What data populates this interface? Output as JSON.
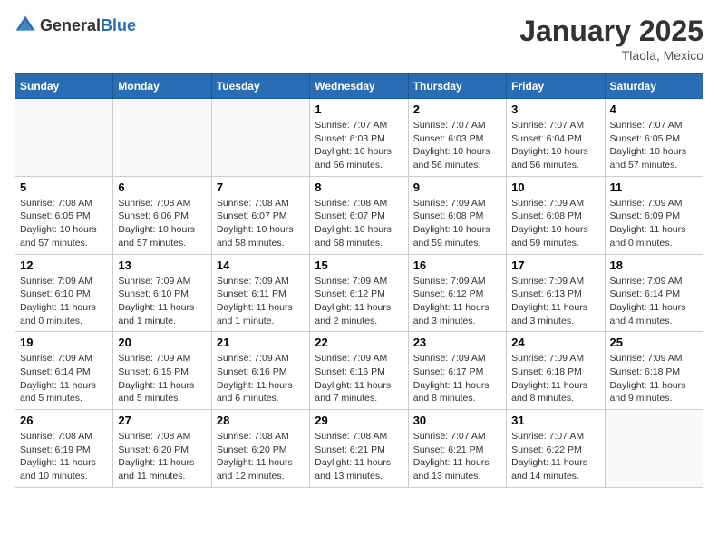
{
  "header": {
    "logo_general": "General",
    "logo_blue": "Blue",
    "month_title": "January 2025",
    "location": "Tlaola, Mexico"
  },
  "days_of_week": [
    "Sunday",
    "Monday",
    "Tuesday",
    "Wednesday",
    "Thursday",
    "Friday",
    "Saturday"
  ],
  "weeks": [
    [
      {
        "day": "",
        "info": ""
      },
      {
        "day": "",
        "info": ""
      },
      {
        "day": "",
        "info": ""
      },
      {
        "day": "1",
        "info": "Sunrise: 7:07 AM\nSunset: 6:03 PM\nDaylight: 10 hours\nand 56 minutes."
      },
      {
        "day": "2",
        "info": "Sunrise: 7:07 AM\nSunset: 6:03 PM\nDaylight: 10 hours\nand 56 minutes."
      },
      {
        "day": "3",
        "info": "Sunrise: 7:07 AM\nSunset: 6:04 PM\nDaylight: 10 hours\nand 56 minutes."
      },
      {
        "day": "4",
        "info": "Sunrise: 7:07 AM\nSunset: 6:05 PM\nDaylight: 10 hours\nand 57 minutes."
      }
    ],
    [
      {
        "day": "5",
        "info": "Sunrise: 7:08 AM\nSunset: 6:05 PM\nDaylight: 10 hours\nand 57 minutes."
      },
      {
        "day": "6",
        "info": "Sunrise: 7:08 AM\nSunset: 6:06 PM\nDaylight: 10 hours\nand 57 minutes."
      },
      {
        "day": "7",
        "info": "Sunrise: 7:08 AM\nSunset: 6:07 PM\nDaylight: 10 hours\nand 58 minutes."
      },
      {
        "day": "8",
        "info": "Sunrise: 7:08 AM\nSunset: 6:07 PM\nDaylight: 10 hours\nand 58 minutes."
      },
      {
        "day": "9",
        "info": "Sunrise: 7:09 AM\nSunset: 6:08 PM\nDaylight: 10 hours\nand 59 minutes."
      },
      {
        "day": "10",
        "info": "Sunrise: 7:09 AM\nSunset: 6:08 PM\nDaylight: 10 hours\nand 59 minutes."
      },
      {
        "day": "11",
        "info": "Sunrise: 7:09 AM\nSunset: 6:09 PM\nDaylight: 11 hours\nand 0 minutes."
      }
    ],
    [
      {
        "day": "12",
        "info": "Sunrise: 7:09 AM\nSunset: 6:10 PM\nDaylight: 11 hours\nand 0 minutes."
      },
      {
        "day": "13",
        "info": "Sunrise: 7:09 AM\nSunset: 6:10 PM\nDaylight: 11 hours\nand 1 minute."
      },
      {
        "day": "14",
        "info": "Sunrise: 7:09 AM\nSunset: 6:11 PM\nDaylight: 11 hours\nand 1 minute."
      },
      {
        "day": "15",
        "info": "Sunrise: 7:09 AM\nSunset: 6:12 PM\nDaylight: 11 hours\nand 2 minutes."
      },
      {
        "day": "16",
        "info": "Sunrise: 7:09 AM\nSunset: 6:12 PM\nDaylight: 11 hours\nand 3 minutes."
      },
      {
        "day": "17",
        "info": "Sunrise: 7:09 AM\nSunset: 6:13 PM\nDaylight: 11 hours\nand 3 minutes."
      },
      {
        "day": "18",
        "info": "Sunrise: 7:09 AM\nSunset: 6:14 PM\nDaylight: 11 hours\nand 4 minutes."
      }
    ],
    [
      {
        "day": "19",
        "info": "Sunrise: 7:09 AM\nSunset: 6:14 PM\nDaylight: 11 hours\nand 5 minutes."
      },
      {
        "day": "20",
        "info": "Sunrise: 7:09 AM\nSunset: 6:15 PM\nDaylight: 11 hours\nand 5 minutes."
      },
      {
        "day": "21",
        "info": "Sunrise: 7:09 AM\nSunset: 6:16 PM\nDaylight: 11 hours\nand 6 minutes."
      },
      {
        "day": "22",
        "info": "Sunrise: 7:09 AM\nSunset: 6:16 PM\nDaylight: 11 hours\nand 7 minutes."
      },
      {
        "day": "23",
        "info": "Sunrise: 7:09 AM\nSunset: 6:17 PM\nDaylight: 11 hours\nand 8 minutes."
      },
      {
        "day": "24",
        "info": "Sunrise: 7:09 AM\nSunset: 6:18 PM\nDaylight: 11 hours\nand 8 minutes."
      },
      {
        "day": "25",
        "info": "Sunrise: 7:09 AM\nSunset: 6:18 PM\nDaylight: 11 hours\nand 9 minutes."
      }
    ],
    [
      {
        "day": "26",
        "info": "Sunrise: 7:08 AM\nSunset: 6:19 PM\nDaylight: 11 hours\nand 10 minutes."
      },
      {
        "day": "27",
        "info": "Sunrise: 7:08 AM\nSunset: 6:20 PM\nDaylight: 11 hours\nand 11 minutes."
      },
      {
        "day": "28",
        "info": "Sunrise: 7:08 AM\nSunset: 6:20 PM\nDaylight: 11 hours\nand 12 minutes."
      },
      {
        "day": "29",
        "info": "Sunrise: 7:08 AM\nSunset: 6:21 PM\nDaylight: 11 hours\nand 13 minutes."
      },
      {
        "day": "30",
        "info": "Sunrise: 7:07 AM\nSunset: 6:21 PM\nDaylight: 11 hours\nand 13 minutes."
      },
      {
        "day": "31",
        "info": "Sunrise: 7:07 AM\nSunset: 6:22 PM\nDaylight: 11 hours\nand 14 minutes."
      },
      {
        "day": "",
        "info": ""
      }
    ]
  ]
}
